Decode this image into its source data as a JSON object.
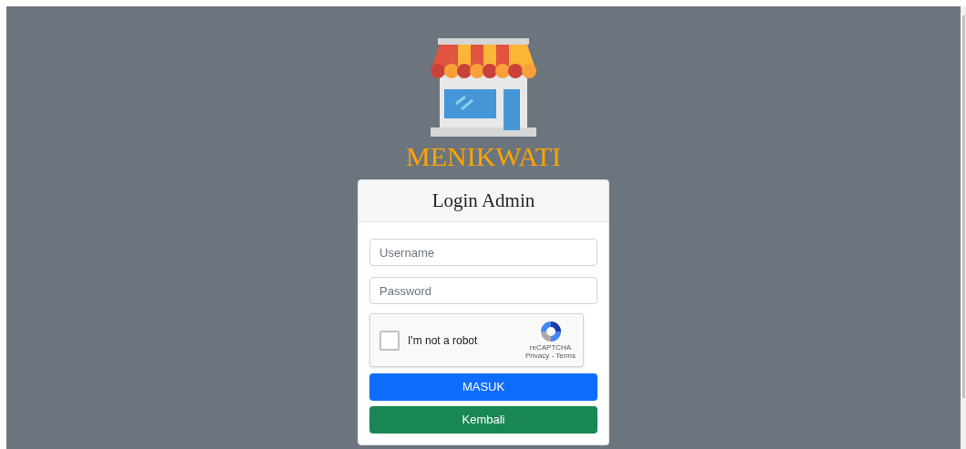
{
  "brand": {
    "name": "MENIKWATI"
  },
  "card": {
    "title": "Login Admin"
  },
  "fields": [
    {
      "placeholder": "Username"
    },
    {
      "placeholder": "Password"
    }
  ],
  "captcha": {
    "label": "I'm not a robot",
    "checked": false,
    "brand": "reCAPTCHA",
    "links": "Privacy - Terms"
  },
  "buttons": [
    {
      "label": "MASUK",
      "kind": "primary"
    },
    {
      "label": "Kembali",
      "kind": "success"
    }
  ]
}
